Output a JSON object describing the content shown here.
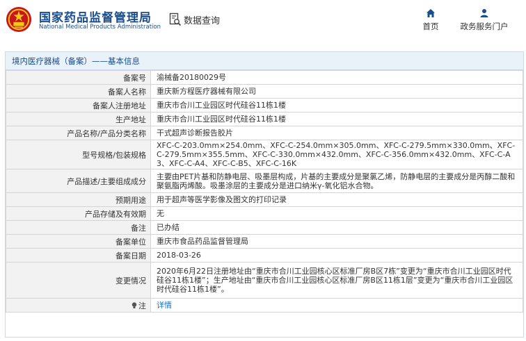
{
  "header": {
    "title_cn": "国家药品监督管理局",
    "title_en": "National Medical Products Administration",
    "query_label": "数据查询",
    "nav": [
      {
        "label": "首页",
        "icon": "home-icon"
      },
      {
        "label": "政务服务门户",
        "icon": "user-icon"
      }
    ],
    "colors": {
      "brand": "#1a4d8c",
      "link": "#1a6fc2",
      "label_bg": "#f2f2f2",
      "title_bg": "#e9f1f9"
    }
  },
  "panel": {
    "title": "境内医疗器械（备案）——基本信息"
  },
  "rows": [
    {
      "label": "备案号",
      "value": "渝械备20180029号"
    },
    {
      "label": "备案人名称",
      "value": "重庆新方程医疗器械有限公司"
    },
    {
      "label": "备案人注册地址",
      "value": "重庆市合川工业园区时代硅谷11栋1楼"
    },
    {
      "label": "生产地址",
      "value": "重庆市合川工业园区时代硅谷11栋1楼"
    },
    {
      "label": "产品名称/产品分类名称",
      "value": "干式超声诊断报告胶片"
    },
    {
      "label": "型号规格/包装规格",
      "value": "XFC-C-203.0mm×254.0mm、XFC-C-254.0mm×305.0mm、XFC-C-279.5mm×330.0mm、XFC-C-279.5mm×355.5mm、XFC-C-330.0mm×432.0mm、XFC-C-356.0mm×432.0mm、XFC-C-A3、XFC-C-A4、XFC-C-B5、XFC-C-16K"
    },
    {
      "label": "产品描述/主要组成成分",
      "value": "主要由PET片基和防静电层、吸墨层构成，片基的主要成分是聚氯乙烯，防静电层的主要成分是丙醇二酸和聚氨脂丙烯酸。吸墨涂层的主要成分是进口纳米γ-氧化铝水合物。"
    },
    {
      "label": "预期用途",
      "value": "用于超声等医学影像及图文的打印记录"
    },
    {
      "label": "产品存储及有效期",
      "value": "无"
    },
    {
      "label": "备注",
      "value": "已办结"
    },
    {
      "label": "备案单位",
      "value": "重庆市食品药品监督管理局"
    },
    {
      "label": "备案日期",
      "value": "2018-03-26"
    },
    {
      "label": "变更情况",
      "value": "2020年6月22日注册地址由“重庆市合川工业园核心区标准厂房B区7栋”变更为“重庆市合川工业园区时代硅谷11栋1楼”；生产地址由“重庆市合川工业园核心区标准厂房B区11栋1层”变更为“重庆市合川工业园区时代硅谷11栋1楼”。"
    },
    {
      "label": "注",
      "value": "详情"
    }
  ]
}
